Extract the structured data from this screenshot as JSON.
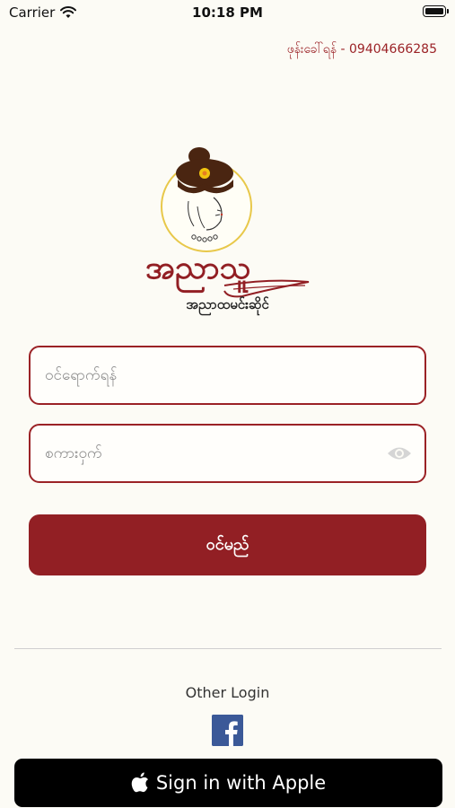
{
  "status_bar": {
    "carrier": "Carrier",
    "time": "10:18 PM"
  },
  "header": {
    "hotline": "ဖုန်းခေါ်ရန် - 09404666285"
  },
  "brand": {
    "logo_text": "အညာသူ",
    "subtitle": "အညာထမင်းဆိုင်"
  },
  "form": {
    "username_placeholder": "ဝင်ရောက်ရန်",
    "password_placeholder": "စကားဝှက်",
    "login_label": "ဝင်မည်"
  },
  "social": {
    "other_login_label": "Other Login",
    "facebook_icon": "facebook-icon",
    "apple_label": "Sign in with Apple"
  },
  "colors": {
    "accent": "#921f24",
    "background": "#fcfbf5",
    "facebook": "#3b5998"
  }
}
